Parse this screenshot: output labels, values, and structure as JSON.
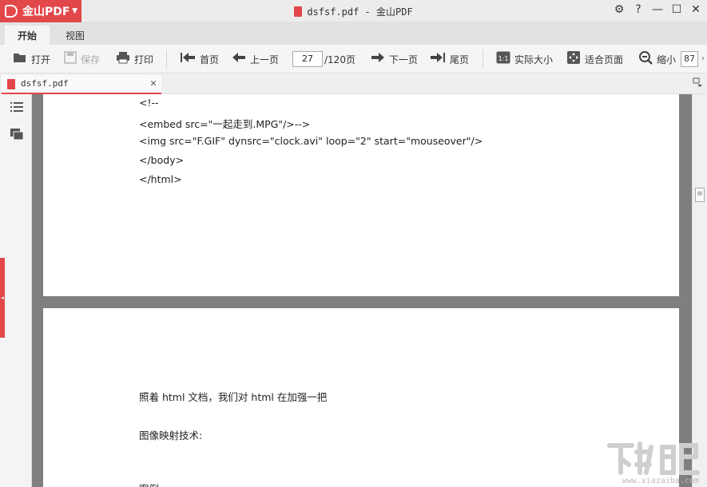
{
  "app": {
    "brand": "金山PDF",
    "window_title": "dsfsf.pdf - 金山PDF",
    "controls": {
      "settings": "⚙",
      "help": "?",
      "minimize": "—",
      "maximize": "☐",
      "close": "✕"
    }
  },
  "menu": {
    "tabs": [
      {
        "label": "开始",
        "active": true
      },
      {
        "label": "视图",
        "active": false
      }
    ]
  },
  "toolbar": {
    "open": "打开",
    "save": "保存",
    "print": "打印",
    "first_page": "首页",
    "prev_page": "上一页",
    "current_page": "27",
    "total_pages": "/120页",
    "next_page": "下一页",
    "last_page": "尾页",
    "actual_size": "实际大小",
    "fit_page": "适合页面",
    "zoom_out": "缩小",
    "zoom_value": "87"
  },
  "document_tab": {
    "name": "dsfsf.pdf"
  },
  "pages": {
    "page1_lines": [
      "<!--",
      "<embed src=\"一起走到.MPG\"/>-->",
      "<img src=\"F.GIF\" dynsrc=\"clock.avi\" loop=\"2\" start=\"mouseover\"/>",
      "</body>",
      "</html>"
    ],
    "page2_lines": [
      "照着 html 文档，我们对 html 在加强一把",
      "图像映射技术:",
      "案例:"
    ]
  },
  "watermark": {
    "text": "下载吧",
    "url": "www.xiazaiba.com"
  },
  "colors": {
    "brand": "#e2474a",
    "viewer_bg": "#7f7f7f"
  }
}
